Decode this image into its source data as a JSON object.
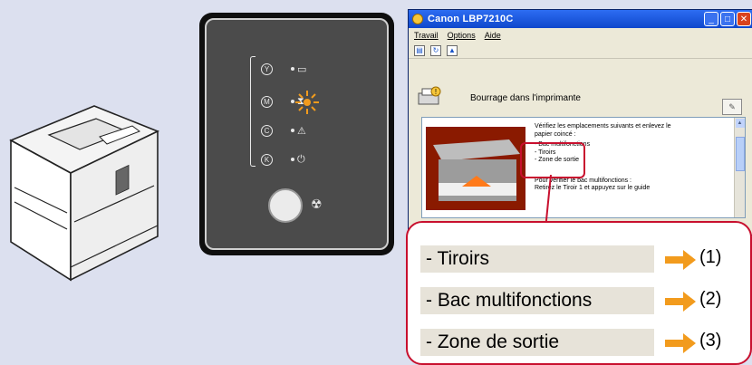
{
  "window": {
    "title": "Canon LBP7210C",
    "minimize_icon": "minimize-icon",
    "maximize_icon": "maximize-icon",
    "close_icon": "close-icon"
  },
  "menu": {
    "items": [
      "Travail",
      "Options",
      "Aide"
    ]
  },
  "status": {
    "message": "Bourrage dans l'imprimante"
  },
  "details": {
    "line1": "Vérifiez les emplacements suivants et enlevez le",
    "line2": "papier coincé :",
    "line3": "- Bac multifonctions",
    "line4": "- Tiroirs",
    "line5": "- Zone de sortie",
    "line6": "Pour vérifier le bac multifonctions :",
    "line7": "Retirez le Tiroir 1 et appuyez sur le guide"
  },
  "control_panel": {
    "stop_symbol": "☢"
  },
  "callout": {
    "items": [
      {
        "label": "- Tiroirs",
        "number": "(1)"
      },
      {
        "label": "- Bac multifonctions",
        "number": "(2)"
      },
      {
        "label": "- Zone de sortie",
        "number": "(3)"
      }
    ]
  },
  "colors": {
    "accent": "#c8102e",
    "arrow": "#f29b1d",
    "background": "#dce0ef",
    "titlebar": "#0f47cc"
  }
}
